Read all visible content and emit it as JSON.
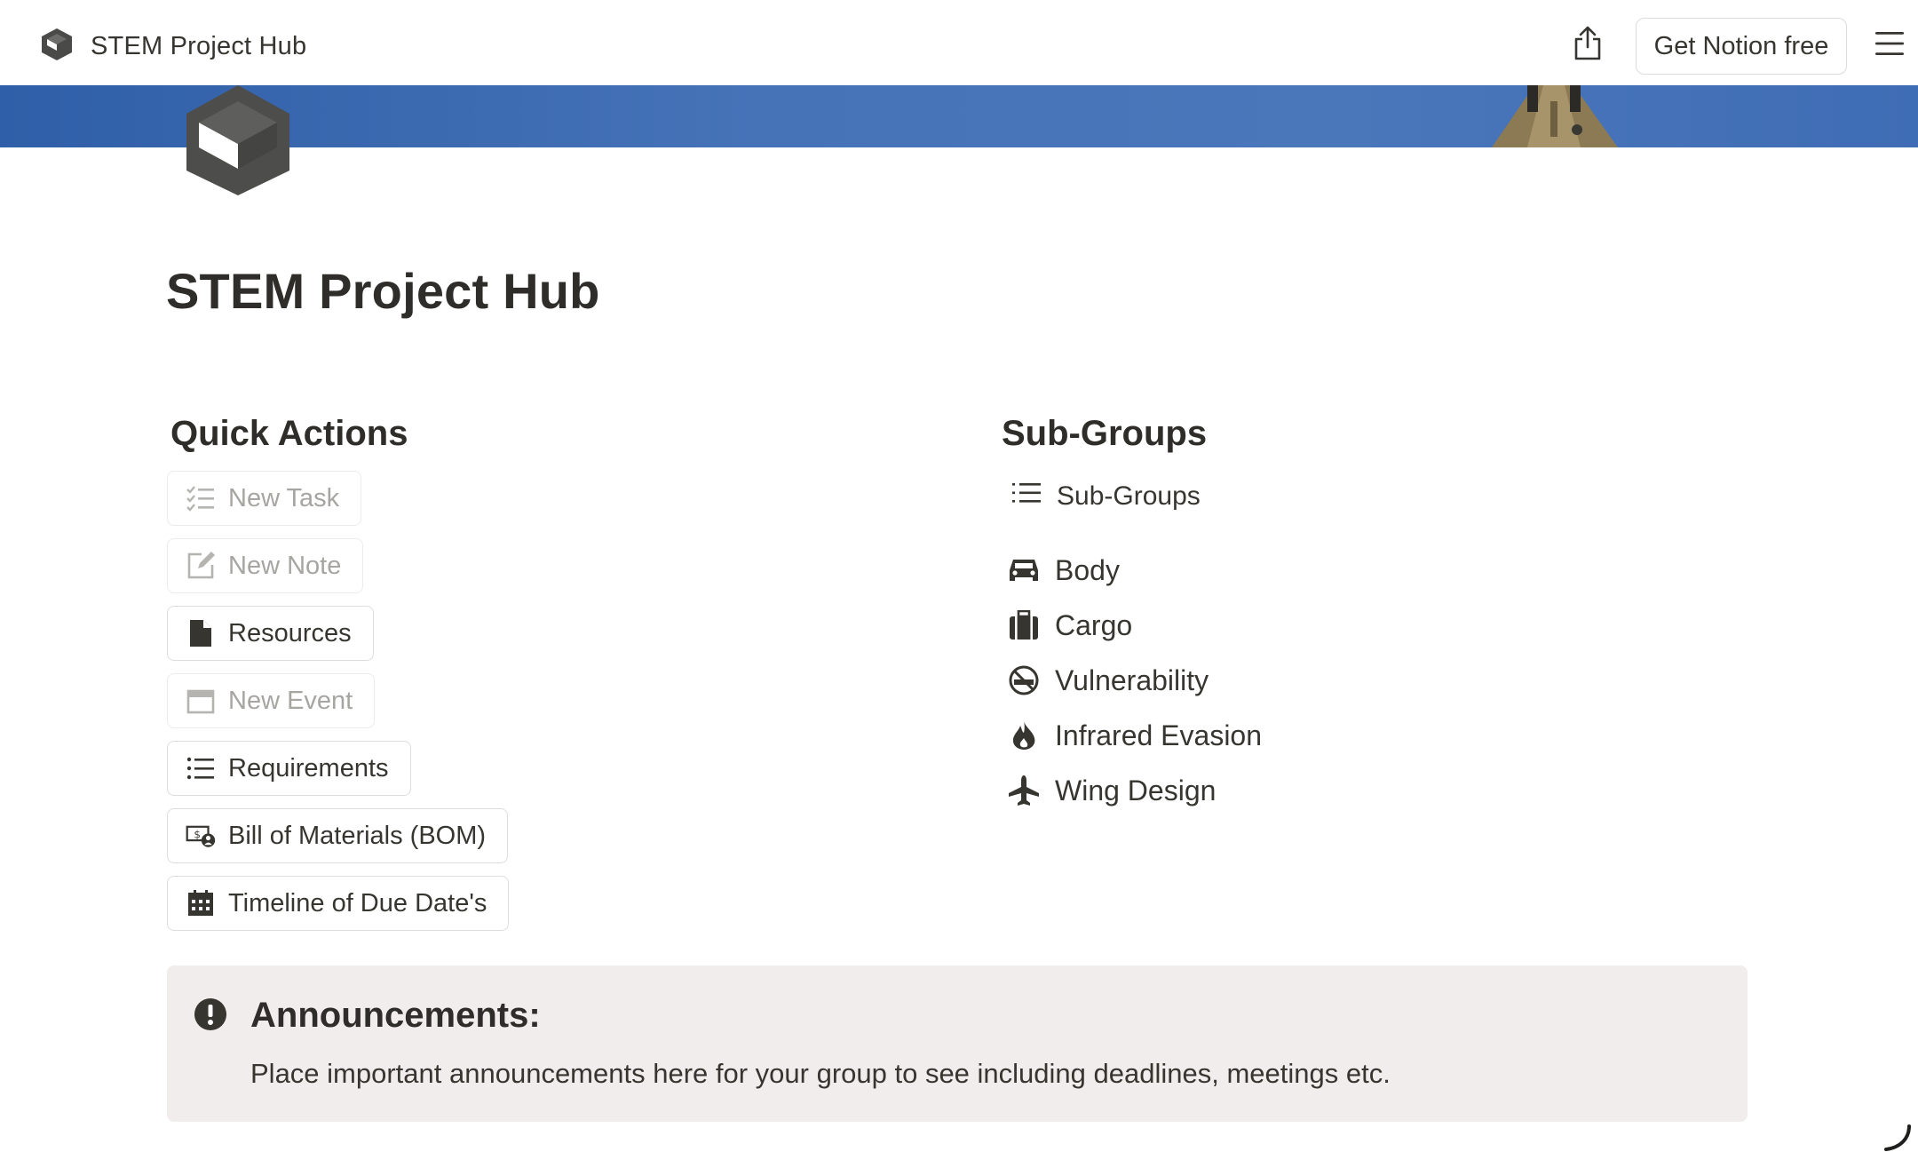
{
  "topbar": {
    "breadcrumb_title": "STEM Project Hub",
    "get_notion_label": "Get Notion free"
  },
  "page": {
    "title": "STEM Project Hub"
  },
  "quick_actions": {
    "heading": "Quick Actions",
    "buttons": [
      {
        "label": "New Task",
        "icon": "checklist-icon",
        "disabled": true
      },
      {
        "label": "New Note",
        "icon": "edit-icon",
        "disabled": true
      },
      {
        "label": "Resources",
        "icon": "document-icon",
        "disabled": false
      },
      {
        "label": "New Event",
        "icon": "calendar-icon",
        "disabled": true
      },
      {
        "label": "Requirements",
        "icon": "list-icon",
        "disabled": false
      },
      {
        "label": "Bill of Materials (BOM)",
        "icon": "money-icon",
        "disabled": false
      },
      {
        "label": "Timeline of Due Date's",
        "icon": "calendar-grid-icon",
        "disabled": false
      }
    ]
  },
  "sub_groups": {
    "heading": "Sub-Groups",
    "view_label": "Sub-Groups",
    "items": [
      {
        "label": "Body",
        "icon": "car-icon"
      },
      {
        "label": "Cargo",
        "icon": "luggage-icon"
      },
      {
        "label": "Vulnerability",
        "icon": "no-smoking-icon"
      },
      {
        "label": "Infrared Evasion",
        "icon": "flame-icon"
      },
      {
        "label": "Wing Design",
        "icon": "airplane-icon"
      }
    ]
  },
  "callout": {
    "title": "Announcements:",
    "body": "Place important announcements here for your group to see including deadlines, meetings etc."
  },
  "colors": {
    "cover": "#4673b8",
    "callout_bg": "#f2eded",
    "text": "#37352f",
    "disabled_text": "#a6a5a1"
  }
}
